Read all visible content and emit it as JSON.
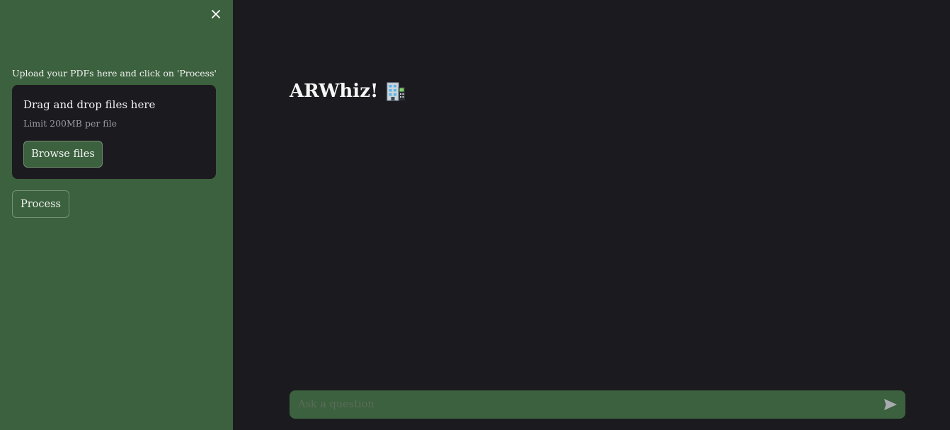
{
  "sidebar": {
    "upload_label": "Upload your PDFs here and click on 'Process'",
    "dropzone": {
      "title": "Drag and drop files here",
      "limit": "Limit 200MB per file",
      "browse_label": "Browse files"
    },
    "process_label": "Process",
    "close_icon": "close-icon"
  },
  "main": {
    "title": "ARWhiz!",
    "title_icon": "office-building-icon",
    "chat": {
      "placeholder": "Ask a question",
      "value": "",
      "send_icon": "send-icon"
    }
  },
  "colors": {
    "sidebar_bg": "#3c613e",
    "main_bg": "#1b1a1f",
    "text": "#f2f2f2"
  }
}
